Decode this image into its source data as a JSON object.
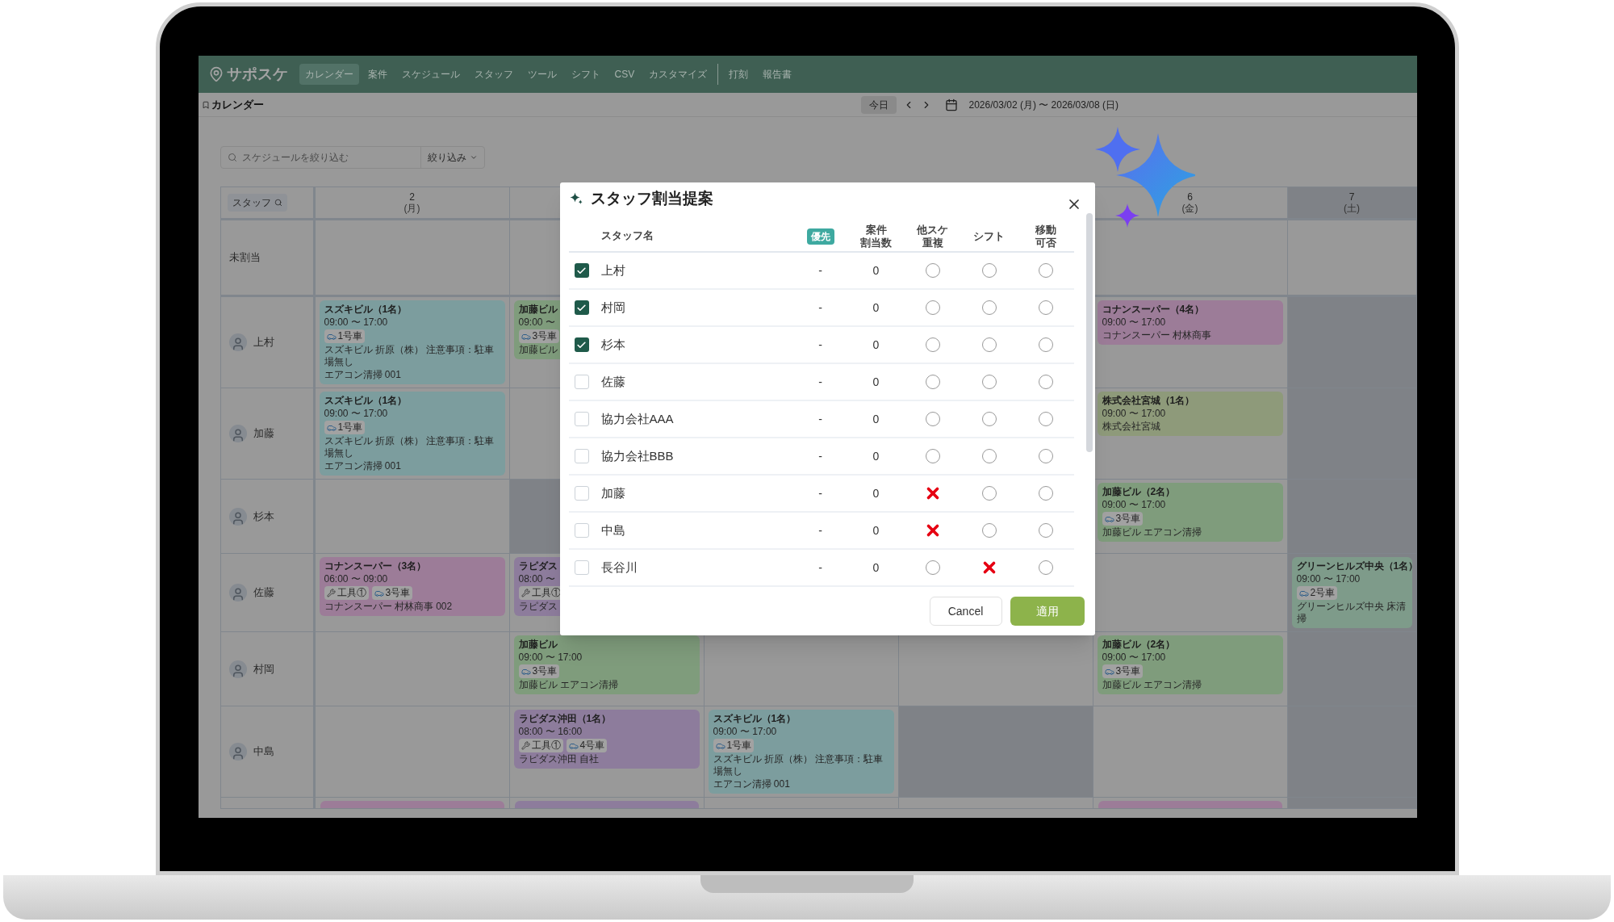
{
  "app": {
    "logo": "サポスケ",
    "nav": [
      {
        "label": "カレンダー",
        "selected": true
      },
      {
        "label": "案件",
        "selected": false
      },
      {
        "label": "スケジュール",
        "selected": false
      },
      {
        "label": "スタッフ",
        "selected": false
      },
      {
        "label": "ツール",
        "selected": false
      },
      {
        "label": "シフト",
        "selected": false
      },
      {
        "label": "CSV",
        "selected": false
      },
      {
        "label": "カスタマイズ",
        "selected": false
      }
    ],
    "nav_extra": [
      {
        "label": "打刻",
        "selected": false
      },
      {
        "label": "報告書",
        "selected": false
      }
    ]
  },
  "toolbar": {
    "page_title": "カレンダー",
    "today_button": "今日",
    "date_range": "2026/03/02 (月) 〜 2026/03/08 (日)"
  },
  "filter": {
    "placeholder": "スケジュールを絞り込む",
    "dropdown": "絞り込み"
  },
  "calendar": {
    "staff_header": "スタッフ",
    "unassigned_label": "未割当",
    "days": [
      {
        "date": "2",
        "weekday": "(月)",
        "shaded": false
      },
      {
        "date": "6",
        "weekday": "(金)",
        "shaded": false
      },
      {
        "date": "7",
        "weekday": "(土)",
        "shaded": true
      }
    ],
    "rows": [
      {
        "name": "上村",
        "cells": [
          {
            "shaded": false,
            "event": {
              "title": "スズキビル（1名）",
              "time": "09:00 〜 17:00",
              "badges": [
                {
                  "kind": "car",
                  "label": "1号車"
                }
              ],
              "notes": [
                "スズキビル 折原（株） 注意事項：駐車場無し",
                "エアコン清掃 001"
              ],
              "color": "#7c9d9e"
            }
          },
          {
            "shaded": false,
            "event": {
              "title": "加藤ビル",
              "time": "09:00 〜",
              "badges": [
                {
                  "kind": "car",
                  "label": "3号車"
                }
              ],
              "notes": [
                "加藤ビル"
              ],
              "color": "#7f9c7c"
            }
          },
          {},
          {},
          {
            "shaded": false,
            "event": {
              "title": "コナンスーパー（4名）",
              "time": "09:00 〜 17:00",
              "notes": [
                "コナンスーパー 村林商事"
              ],
              "color": "#9c7c98"
            }
          },
          {
            "shaded": true
          }
        ]
      },
      {
        "name": "加藤",
        "cells": [
          {
            "shaded": false,
            "event": {
              "title": "スズキビル（1名）",
              "time": "09:00 〜 17:00",
              "badges": [
                {
                  "kind": "car",
                  "label": "1号車"
                }
              ],
              "notes": [
                "スズキビル 折原（株） 注意事項：駐車場無し",
                "エアコン清掃 001"
              ],
              "color": "#7c9d9e"
            }
          },
          {},
          {},
          {},
          {
            "shaded": false,
            "event": {
              "title": "株式会社宮城（1名）",
              "time": "09:00 〜 17:00",
              "notes": [
                "株式会社宮城"
              ],
              "color": "#8e9a7a"
            }
          },
          {
            "shaded": true
          }
        ]
      },
      {
        "name": "杉本",
        "cells": [
          {
            "shaded": false
          },
          {
            "shaded": true
          },
          {},
          {},
          {
            "shaded": false,
            "event": {
              "title": "加藤ビル（2名）",
              "time": "09:00 〜 17:00",
              "badges": [
                {
                  "kind": "car",
                  "label": "3号車"
                }
              ],
              "notes": [
                "加藤ビル エアコン清掃"
              ],
              "color": "#7f9c7c"
            }
          },
          {
            "shaded": true
          }
        ]
      },
      {
        "name": "佐藤",
        "cells": [
          {
            "shaded": false,
            "event": {
              "title": "コナンスーパー（3名）",
              "time": "06:00 〜 09:00",
              "badges": [
                {
                  "kind": "tool",
                  "label": "工具①"
                },
                {
                  "kind": "car",
                  "label": "3号車"
                }
              ],
              "notes": [
                "コナンスーパー 村林商事 002"
              ],
              "color": "#9c7c98"
            }
          },
          {
            "shaded": false,
            "event": {
              "title": "ラピダス",
              "time": "08:00 〜",
              "badges": [
                {
                  "kind": "tool",
                  "label": "工具①"
                }
              ],
              "notes": [
                "ラピダス"
              ],
              "color": "#8d7c9c"
            }
          },
          {},
          {},
          {
            "shaded": false
          },
          {
            "shaded": true,
            "event": {
              "title": "グリーンヒルズ中央（1名）",
              "time": "09:00 〜 17:00",
              "badges": [
                {
                  "kind": "car",
                  "label": "2号車"
                }
              ],
              "notes": [
                "グリーンヒルズ中央 床清掃"
              ],
              "color": "#7e9b8a"
            }
          }
        ]
      },
      {
        "name": "村岡",
        "cells": [
          {
            "shaded": false
          },
          {
            "shaded": false,
            "event": {
              "title": "加藤ビル",
              "time": "09:00 〜 17:00",
              "badges": [
                {
                  "kind": "car",
                  "label": "3号車"
                }
              ],
              "notes": [
                "加藤ビル エアコン清掃"
              ],
              "color": "#7f9c7c"
            }
          },
          {
            "shaded": false
          },
          {
            "shaded": false
          },
          {
            "shaded": false,
            "event": {
              "title": "加藤ビル（2名）",
              "time": "09:00 〜 17:00",
              "badges": [
                {
                  "kind": "car",
                  "label": "3号車"
                }
              ],
              "notes": [
                "加藤ビル エアコン清掃"
              ],
              "color": "#7f9c7c"
            }
          },
          {
            "shaded": true
          }
        ]
      },
      {
        "name": "中島",
        "cells": [
          {
            "shaded": false
          },
          {
            "shaded": false,
            "event": {
              "title": "ラピダス沖田（1名）",
              "time": "08:00 〜 16:00",
              "badges": [
                {
                  "kind": "tool",
                  "label": "工具①"
                },
                {
                  "kind": "car",
                  "label": "4号車"
                }
              ],
              "notes": [
                "ラピダス沖田 自社"
              ],
              "color": "#8d7c9c"
            }
          },
          {
            "shaded": false,
            "event": {
              "title": "スズキビル（1名）",
              "time": "09:00 〜 17:00",
              "badges": [
                {
                  "kind": "car",
                  "label": "1号車"
                }
              ],
              "notes": [
                "スズキビル 折原（株） 注意事項：駐車場無し",
                "エアコン清掃 001"
              ],
              "color": "#7c9d9e"
            }
          },
          {
            "shaded": true
          },
          {
            "shaded": false
          },
          {
            "shaded": true
          }
        ]
      },
      {
        "cells": [
          {
            "shaded": false,
            "event": {
              "color": "#9c7c98"
            }
          },
          {
            "shaded": false,
            "event": {
              "color": "#8d7c9c"
            }
          },
          {
            "shaded": false
          },
          {
            "shaded": false
          },
          {
            "shaded": false,
            "event": {
              "color": "#9c7c98"
            }
          },
          {
            "shaded": true
          }
        ]
      }
    ]
  },
  "modal": {
    "title": "スタッフ割当提案",
    "columns": {
      "name": "スタッフ名",
      "priority": "優先",
      "count": [
        "案件",
        "割当数"
      ],
      "overlap": [
        "他スケ",
        "重複"
      ],
      "shift": [
        "シフト"
      ],
      "move": [
        "移動",
        "可否"
      ]
    },
    "rows": [
      {
        "name": "上村",
        "checked": true,
        "priority": "-",
        "count": "0",
        "overlap_ok": true,
        "shift_ok": true,
        "move_ok": true
      },
      {
        "name": "村岡",
        "checked": true,
        "priority": "-",
        "count": "0",
        "overlap_ok": true,
        "shift_ok": true,
        "move_ok": true
      },
      {
        "name": "杉本",
        "checked": true,
        "priority": "-",
        "count": "0",
        "overlap_ok": true,
        "shift_ok": true,
        "move_ok": true
      },
      {
        "name": "佐藤",
        "checked": false,
        "priority": "-",
        "count": "0",
        "overlap_ok": true,
        "shift_ok": true,
        "move_ok": true
      },
      {
        "name": "協力会社AAA",
        "checked": false,
        "priority": "-",
        "count": "0",
        "overlap_ok": true,
        "shift_ok": true,
        "move_ok": true
      },
      {
        "name": "協力会社BBB",
        "checked": false,
        "priority": "-",
        "count": "0",
        "overlap_ok": true,
        "shift_ok": true,
        "move_ok": true
      },
      {
        "name": "加藤",
        "checked": false,
        "priority": "-",
        "count": "0",
        "overlap_ok": false,
        "shift_ok": true,
        "move_ok": true
      },
      {
        "name": "中島",
        "checked": false,
        "priority": "-",
        "count": "0",
        "overlap_ok": false,
        "shift_ok": true,
        "move_ok": true
      },
      {
        "name": "長谷川",
        "checked": false,
        "priority": "-",
        "count": "0",
        "overlap_ok": true,
        "shift_ok": false,
        "move_ok": true
      }
    ],
    "cancel_button": "Cancel",
    "apply_button": "適用"
  }
}
